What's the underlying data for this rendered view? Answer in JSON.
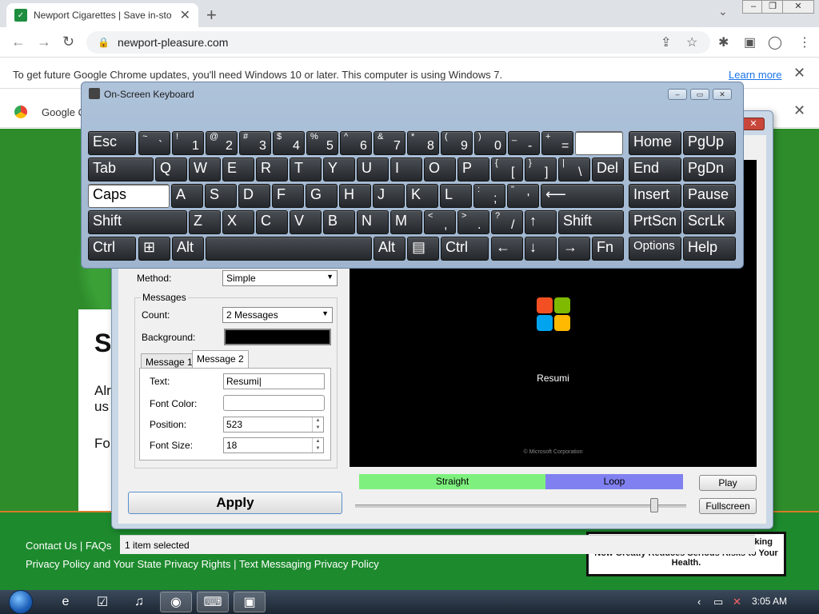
{
  "browser": {
    "tab_title": "Newport Cigarettes | Save in-sto",
    "url": "newport-pleasure.com",
    "infobar_message": "To get future Google Chrome updates, you'll need Windows 10 or later. This computer is using Windows 7.",
    "learn_more": "Learn more",
    "bar2_text": "Google C"
  },
  "website": {
    "heading_letter": "S",
    "text_line1": "Alr",
    "text_line2": "us",
    "text_line3": "Fo",
    "footer_links1": "Contact Us  |  FAQs",
    "footer_links2": "Privacy Policy and Your State Privacy Rights  |  Text Messaging Privacy Policy",
    "warning_top": "oking",
    "warning_text": "Now Greatly Reduces Serious Risks to Your Health."
  },
  "osk": {
    "title": "On-Screen Keyboard",
    "rows": [
      [
        "Esc",
        "~ `",
        "! 1",
        "@ 2",
        "# 3",
        "$ 4",
        "% 5",
        "^ 6",
        "& 7",
        "* 8",
        "( 9",
        ") 0",
        "_ -",
        "+ =",
        "",
        "Home",
        "PgUp"
      ],
      [
        "Tab",
        "Q",
        "W",
        "E",
        "R",
        "T",
        "Y",
        "U",
        "I",
        "O",
        "P",
        "{ [",
        "} ]",
        "| \\",
        "Del",
        "End",
        "PgDn"
      ],
      [
        "Caps",
        "A",
        "S",
        "D",
        "F",
        "G",
        "H",
        "J",
        "K",
        "L",
        ": ;",
        "\" '",
        "⟵",
        "Insert",
        "Pause"
      ],
      [
        "Shift",
        "Z",
        "X",
        "C",
        "V",
        "B",
        "N",
        "M",
        "< ,",
        "> .",
        "? /",
        "↑",
        "Shift",
        "PrtScn",
        "ScrLk"
      ],
      [
        "Ctrl",
        "⊞",
        "Alt",
        "",
        "Alt",
        "▤",
        "Ctrl",
        "←",
        "↓",
        "→",
        "Fn",
        "Options",
        "Help"
      ]
    ]
  },
  "dialog": {
    "method_label": "Method:",
    "method_value": "Simple",
    "messages_group": "Messages",
    "count_label": "Count:",
    "count_value": "2 Messages",
    "background_label": "Background:",
    "tab1": "Message 1",
    "tab2": "Message 2",
    "text_label": "Text:",
    "text_value": "Resumi",
    "font_color_label": "Font Color:",
    "position_label": "Position:",
    "position_value": "523",
    "font_size_label": "Font Size:",
    "font_size_value": "18",
    "apply": "Apply",
    "preview_text": "Resumi",
    "preview_copyright": "© Microsoft Corporation",
    "straight": "Straight",
    "loop": "Loop",
    "play": "Play",
    "fullscreen": "Fullscreen",
    "status": "1 item selected"
  },
  "taskbar": {
    "clock": "3:05 AM"
  }
}
